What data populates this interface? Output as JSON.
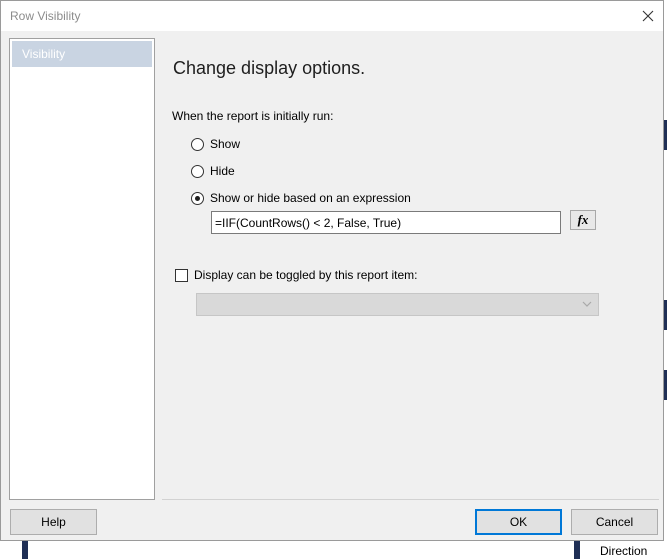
{
  "window": {
    "title": "Row Visibility"
  },
  "sidebar": {
    "items": [
      {
        "label": "Visibility",
        "selected": true
      }
    ]
  },
  "main": {
    "heading": "Change display options.",
    "initial_label": "When the report is initially run:",
    "options": [
      {
        "label": "Show",
        "checked": false
      },
      {
        "label": "Hide",
        "checked": false
      },
      {
        "label": "Show or hide based on an expression",
        "checked": true
      }
    ],
    "expression": {
      "value": "=IIF(CountRows() < 2, False, True)",
      "button_glyph": "fx"
    },
    "toggle": {
      "label": "Display can be toggled by this report item:",
      "checked": false,
      "selected_value": ""
    }
  },
  "footer": {
    "help_label": "Help",
    "ok_label": "OK",
    "cancel_label": "Cancel"
  },
  "background": {
    "direction_label": "Direction"
  },
  "colors": {
    "selected_item": "#c9d4e2",
    "accent_focus": "#0078d7",
    "dialog_bg": "#f0f0f0"
  }
}
